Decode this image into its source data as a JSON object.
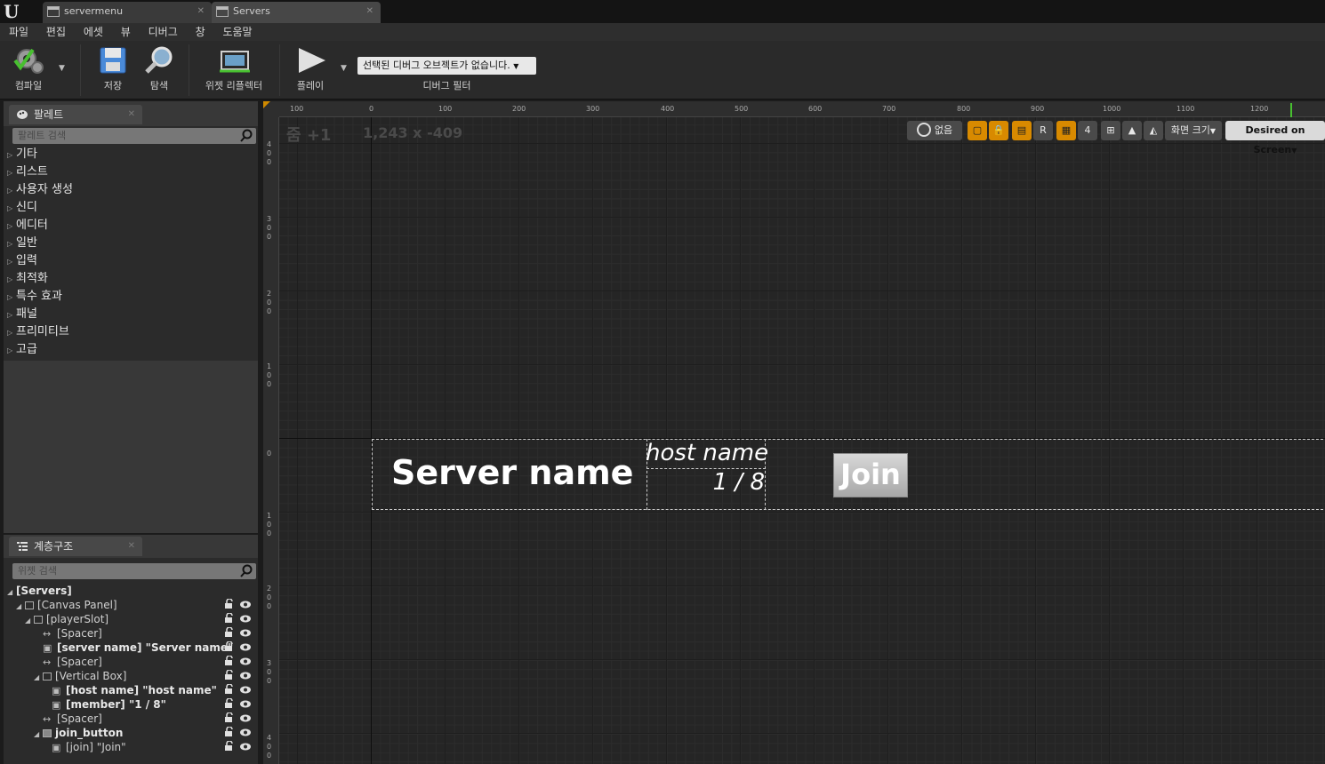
{
  "tabs": [
    {
      "label": "servermenu",
      "active": false
    },
    {
      "label": "Servers",
      "active": true
    }
  ],
  "menu": [
    "파일",
    "편집",
    "에셋",
    "뷰",
    "디버그",
    "창",
    "도움말"
  ],
  "toolbar": {
    "compile": "컴파일",
    "save": "저장",
    "browse": "탐색",
    "widget_reflector": "위젯 리플렉터",
    "play": "플레이",
    "debug_select": "선택된 디버그 오브젝트가 없습니다.",
    "debug_filter": "디버그 필터"
  },
  "palette": {
    "title": "팔레트",
    "search_placeholder": "팔레트 검색",
    "categories": [
      "기타",
      "리스트",
      "사용자 생성",
      "신디",
      "에디터",
      "일반",
      "입력",
      "최적화",
      "특수 효과",
      "패널",
      "프리미티브",
      "고급"
    ]
  },
  "hierarchy": {
    "title": "계층구조",
    "search_placeholder": "위젯 검색",
    "items": [
      {
        "label": "[Servers]",
        "bold": true
      },
      {
        "label": "[Canvas Panel]",
        "bold": false
      },
      {
        "label": "[playerSlot]",
        "bold": false
      },
      {
        "label": "[Spacer]",
        "bold": false
      },
      {
        "label": "[server name] \"Server name\"",
        "bold": true
      },
      {
        "label": "[Spacer]",
        "bold": false
      },
      {
        "label": "[Vertical Box]",
        "bold": false
      },
      {
        "label": "[host name] \"host name\"",
        "bold": true
      },
      {
        "label": "[member] \"1 / 8\"",
        "bold": true
      },
      {
        "label": "[Spacer]",
        "bold": false
      },
      {
        "label": "join_button",
        "bold": true
      },
      {
        "label": "[join] \"Join\"",
        "bold": false
      }
    ]
  },
  "designer": {
    "zoom": "줌 +1",
    "coords": "1,243 x -409",
    "ruler_top": [
      "100",
      "0",
      "100",
      "200",
      "300",
      "400",
      "500",
      "600",
      "700",
      "800",
      "900",
      "1000",
      "1100",
      "1200"
    ],
    "ruler_left": [
      "400",
      "300",
      "200",
      "100",
      "0",
      "100",
      "200",
      "300",
      "400"
    ],
    "tools": {
      "none_label": "없음",
      "r_label": "R",
      "grid_snap": "4",
      "screen_size": "화면 크기",
      "fill_mode": "Desired on Screen"
    }
  },
  "widget_preview": {
    "server_name": "Server name",
    "host_name": "host name",
    "member": "1 / 8",
    "join": "Join"
  }
}
